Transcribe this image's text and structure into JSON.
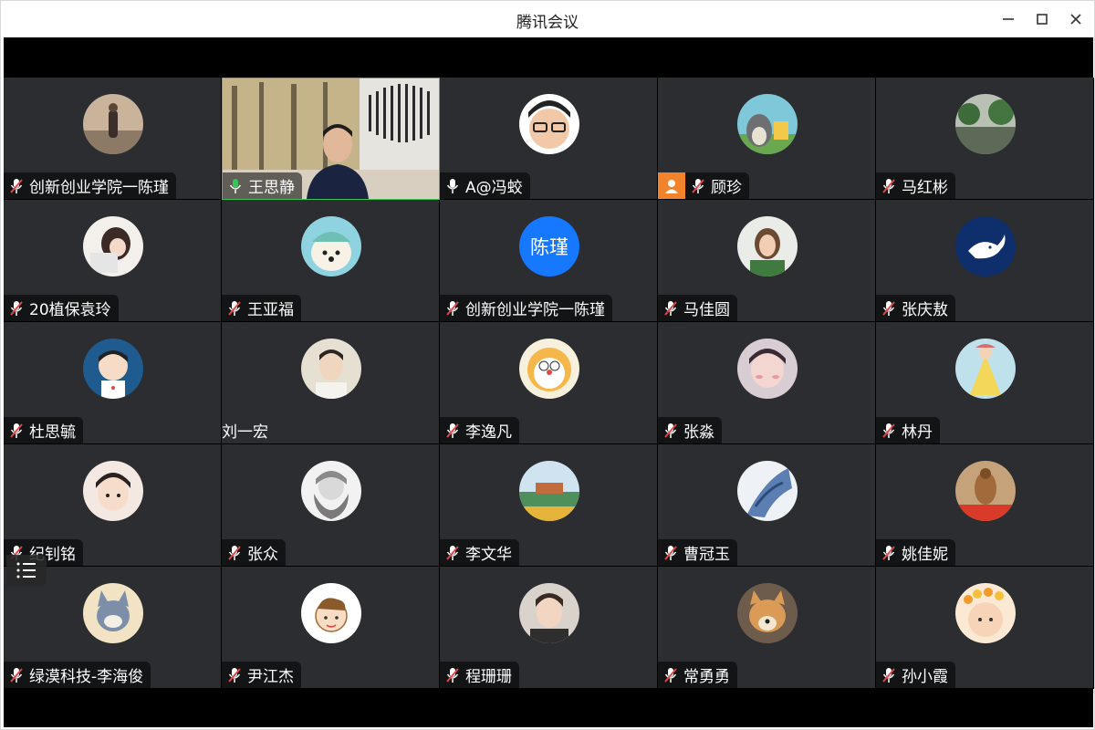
{
  "window": {
    "title": "腾讯会议",
    "controls": {
      "minimize": "minimize-icon",
      "maximize": "maximize-icon",
      "close": "close-icon"
    }
  },
  "participants": [
    {
      "name": "创新创业学院一陈瑾",
      "mic": "muted",
      "avatar": "photo-woman-walking"
    },
    {
      "name": "王思静",
      "mic": "speaking",
      "video": true,
      "active": true
    },
    {
      "name": "A@冯蛟",
      "mic": "on",
      "avatar": "cartoon-man-glasses"
    },
    {
      "name": "顾珍",
      "mic": "muted",
      "host": true,
      "avatar": "totoro-cartoon"
    },
    {
      "name": "马红彬",
      "mic": "muted",
      "avatar": "rainy-road"
    },
    {
      "name": "20植保袁玲",
      "mic": "muted",
      "avatar": "anime-girl"
    },
    {
      "name": "王亚福",
      "mic": "muted",
      "avatar": "white-dog-hat"
    },
    {
      "name": "创新创业学院一陈瑾",
      "mic": "muted",
      "avatar_text": "陈瑾"
    },
    {
      "name": "马佳圆",
      "mic": "muted",
      "avatar": "smiling-woman"
    },
    {
      "name": "张庆敖",
      "mic": "muted",
      "avatar": "whale-icon"
    },
    {
      "name": "杜思毓",
      "mic": "muted",
      "avatar": "cartoon-boy"
    },
    {
      "name": "刘一宏",
      "mic": "none",
      "avatar": "young-man"
    },
    {
      "name": "李逸凡",
      "mic": "muted",
      "avatar": "doraemon-cat"
    },
    {
      "name": "张淼",
      "mic": "muted",
      "avatar": "anime-boy-blush"
    },
    {
      "name": "林丹",
      "mic": "muted",
      "avatar": "painting-yellow-dress"
    },
    {
      "name": "纪钊铭",
      "mic": "muted",
      "avatar": "child-bow"
    },
    {
      "name": "张众",
      "mic": "muted",
      "avatar": "bearded-man-sketch"
    },
    {
      "name": "李文华",
      "mic": "muted",
      "avatar": "garden-lake"
    },
    {
      "name": "曹冠玉",
      "mic": "muted",
      "avatar": "blue-white-art"
    },
    {
      "name": "姚佳妮",
      "mic": "muted",
      "avatar": "armored-figure"
    },
    {
      "name": "绿漠科技-李海俊",
      "mic": "muted",
      "avatar": "tom-cat"
    },
    {
      "name": "尹江杰",
      "mic": "muted",
      "avatar": "cartoon-boy-face"
    },
    {
      "name": "程珊珊",
      "mic": "muted",
      "avatar": "young-man-portrait"
    },
    {
      "name": "常勇勇",
      "mic": "muted",
      "avatar": "shiba-dog"
    },
    {
      "name": "孙小霞",
      "mic": "muted",
      "avatar": "baby-flower-crown"
    }
  ],
  "colors": {
    "tile_bg": "#2b2d31",
    "active_border": "#39c45a",
    "host_badge": "#f2832b",
    "speaking_mic": "#39c45a",
    "muted_slash": "#e04848"
  },
  "toolbar": {
    "list_icon": "list-icon"
  }
}
